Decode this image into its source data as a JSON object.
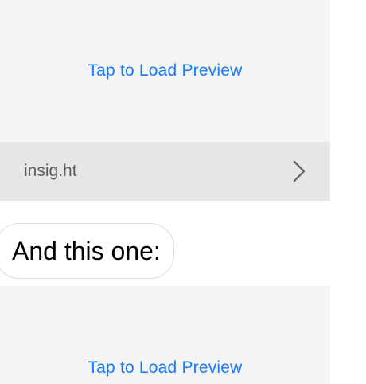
{
  "preview_cards": [
    {
      "tap_label": "Tap to Load Preview"
    },
    {
      "tap_label": "Tap to Load Preview"
    }
  ],
  "link_bar": {
    "domain": "insig.ht",
    "chevron_icon": "chevron-right-icon"
  },
  "message": {
    "text": "And this one:"
  },
  "colors": {
    "link_blue": "#1a7cf0",
    "card_background": "#f4f4f4",
    "domain_bar_background": "#e6e6e6"
  }
}
